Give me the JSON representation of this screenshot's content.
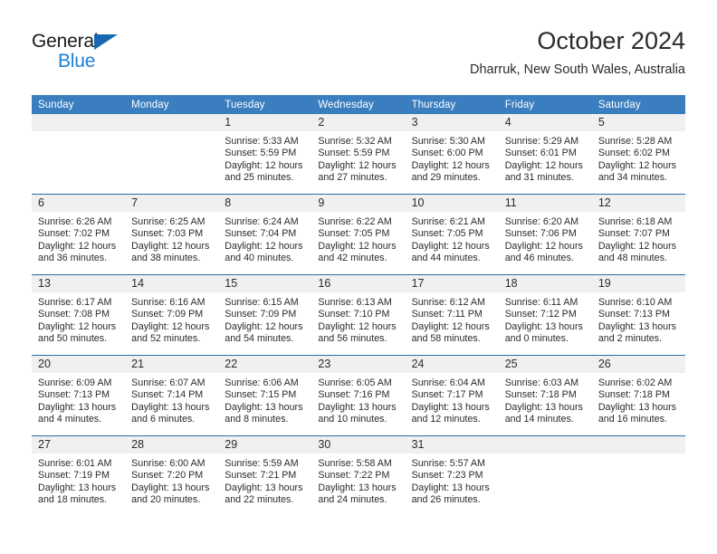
{
  "brand": {
    "name_top": "General",
    "name_bottom": "Blue",
    "triangle_icon": "triangle-icon",
    "color_black": "#1a1a1a",
    "color_blue": "#1b7fd4",
    "accent_blue": "#1668b3"
  },
  "header": {
    "title": "October 2024",
    "subtitle": "Dharruk, New South Wales, Australia"
  },
  "colors": {
    "header_row_bg": "#3a7ebf",
    "header_row_text": "#ffffff",
    "daynum_band_bg": "#f0f0f0",
    "week_separator": "#2e6da4",
    "body_text": "#2b2b2b"
  },
  "weekday_headers": [
    "Sunday",
    "Monday",
    "Tuesday",
    "Wednesday",
    "Thursday",
    "Friday",
    "Saturday"
  ],
  "labels": {
    "sunrise_prefix": "Sunrise:",
    "sunset_prefix": "Sunset:",
    "daylight_prefix": "Daylight:"
  },
  "weeks": [
    [
      {
        "day": "",
        "sunrise": "",
        "sunset": "",
        "daylight_line1": "",
        "daylight_line2": ""
      },
      {
        "day": "",
        "sunrise": "",
        "sunset": "",
        "daylight_line1": "",
        "daylight_line2": ""
      },
      {
        "day": "1",
        "sunrise": "Sunrise: 5:33 AM",
        "sunset": "Sunset: 5:59 PM",
        "daylight_line1": "Daylight: 12 hours",
        "daylight_line2": "and 25 minutes."
      },
      {
        "day": "2",
        "sunrise": "Sunrise: 5:32 AM",
        "sunset": "Sunset: 5:59 PM",
        "daylight_line1": "Daylight: 12 hours",
        "daylight_line2": "and 27 minutes."
      },
      {
        "day": "3",
        "sunrise": "Sunrise: 5:30 AM",
        "sunset": "Sunset: 6:00 PM",
        "daylight_line1": "Daylight: 12 hours",
        "daylight_line2": "and 29 minutes."
      },
      {
        "day": "4",
        "sunrise": "Sunrise: 5:29 AM",
        "sunset": "Sunset: 6:01 PM",
        "daylight_line1": "Daylight: 12 hours",
        "daylight_line2": "and 31 minutes."
      },
      {
        "day": "5",
        "sunrise": "Sunrise: 5:28 AM",
        "sunset": "Sunset: 6:02 PM",
        "daylight_line1": "Daylight: 12 hours",
        "daylight_line2": "and 34 minutes."
      }
    ],
    [
      {
        "day": "6",
        "sunrise": "Sunrise: 6:26 AM",
        "sunset": "Sunset: 7:02 PM",
        "daylight_line1": "Daylight: 12 hours",
        "daylight_line2": "and 36 minutes."
      },
      {
        "day": "7",
        "sunrise": "Sunrise: 6:25 AM",
        "sunset": "Sunset: 7:03 PM",
        "daylight_line1": "Daylight: 12 hours",
        "daylight_line2": "and 38 minutes."
      },
      {
        "day": "8",
        "sunrise": "Sunrise: 6:24 AM",
        "sunset": "Sunset: 7:04 PM",
        "daylight_line1": "Daylight: 12 hours",
        "daylight_line2": "and 40 minutes."
      },
      {
        "day": "9",
        "sunrise": "Sunrise: 6:22 AM",
        "sunset": "Sunset: 7:05 PM",
        "daylight_line1": "Daylight: 12 hours",
        "daylight_line2": "and 42 minutes."
      },
      {
        "day": "10",
        "sunrise": "Sunrise: 6:21 AM",
        "sunset": "Sunset: 7:05 PM",
        "daylight_line1": "Daylight: 12 hours",
        "daylight_line2": "and 44 minutes."
      },
      {
        "day": "11",
        "sunrise": "Sunrise: 6:20 AM",
        "sunset": "Sunset: 7:06 PM",
        "daylight_line1": "Daylight: 12 hours",
        "daylight_line2": "and 46 minutes."
      },
      {
        "day": "12",
        "sunrise": "Sunrise: 6:18 AM",
        "sunset": "Sunset: 7:07 PM",
        "daylight_line1": "Daylight: 12 hours",
        "daylight_line2": "and 48 minutes."
      }
    ],
    [
      {
        "day": "13",
        "sunrise": "Sunrise: 6:17 AM",
        "sunset": "Sunset: 7:08 PM",
        "daylight_line1": "Daylight: 12 hours",
        "daylight_line2": "and 50 minutes."
      },
      {
        "day": "14",
        "sunrise": "Sunrise: 6:16 AM",
        "sunset": "Sunset: 7:09 PM",
        "daylight_line1": "Daylight: 12 hours",
        "daylight_line2": "and 52 minutes."
      },
      {
        "day": "15",
        "sunrise": "Sunrise: 6:15 AM",
        "sunset": "Sunset: 7:09 PM",
        "daylight_line1": "Daylight: 12 hours",
        "daylight_line2": "and 54 minutes."
      },
      {
        "day": "16",
        "sunrise": "Sunrise: 6:13 AM",
        "sunset": "Sunset: 7:10 PM",
        "daylight_line1": "Daylight: 12 hours",
        "daylight_line2": "and 56 minutes."
      },
      {
        "day": "17",
        "sunrise": "Sunrise: 6:12 AM",
        "sunset": "Sunset: 7:11 PM",
        "daylight_line1": "Daylight: 12 hours",
        "daylight_line2": "and 58 minutes."
      },
      {
        "day": "18",
        "sunrise": "Sunrise: 6:11 AM",
        "sunset": "Sunset: 7:12 PM",
        "daylight_line1": "Daylight: 13 hours",
        "daylight_line2": "and 0 minutes."
      },
      {
        "day": "19",
        "sunrise": "Sunrise: 6:10 AM",
        "sunset": "Sunset: 7:13 PM",
        "daylight_line1": "Daylight: 13 hours",
        "daylight_line2": "and 2 minutes."
      }
    ],
    [
      {
        "day": "20",
        "sunrise": "Sunrise: 6:09 AM",
        "sunset": "Sunset: 7:13 PM",
        "daylight_line1": "Daylight: 13 hours",
        "daylight_line2": "and 4 minutes."
      },
      {
        "day": "21",
        "sunrise": "Sunrise: 6:07 AM",
        "sunset": "Sunset: 7:14 PM",
        "daylight_line1": "Daylight: 13 hours",
        "daylight_line2": "and 6 minutes."
      },
      {
        "day": "22",
        "sunrise": "Sunrise: 6:06 AM",
        "sunset": "Sunset: 7:15 PM",
        "daylight_line1": "Daylight: 13 hours",
        "daylight_line2": "and 8 minutes."
      },
      {
        "day": "23",
        "sunrise": "Sunrise: 6:05 AM",
        "sunset": "Sunset: 7:16 PM",
        "daylight_line1": "Daylight: 13 hours",
        "daylight_line2": "and 10 minutes."
      },
      {
        "day": "24",
        "sunrise": "Sunrise: 6:04 AM",
        "sunset": "Sunset: 7:17 PM",
        "daylight_line1": "Daylight: 13 hours",
        "daylight_line2": "and 12 minutes."
      },
      {
        "day": "25",
        "sunrise": "Sunrise: 6:03 AM",
        "sunset": "Sunset: 7:18 PM",
        "daylight_line1": "Daylight: 13 hours",
        "daylight_line2": "and 14 minutes."
      },
      {
        "day": "26",
        "sunrise": "Sunrise: 6:02 AM",
        "sunset": "Sunset: 7:18 PM",
        "daylight_line1": "Daylight: 13 hours",
        "daylight_line2": "and 16 minutes."
      }
    ],
    [
      {
        "day": "27",
        "sunrise": "Sunrise: 6:01 AM",
        "sunset": "Sunset: 7:19 PM",
        "daylight_line1": "Daylight: 13 hours",
        "daylight_line2": "and 18 minutes."
      },
      {
        "day": "28",
        "sunrise": "Sunrise: 6:00 AM",
        "sunset": "Sunset: 7:20 PM",
        "daylight_line1": "Daylight: 13 hours",
        "daylight_line2": "and 20 minutes."
      },
      {
        "day": "29",
        "sunrise": "Sunrise: 5:59 AM",
        "sunset": "Sunset: 7:21 PM",
        "daylight_line1": "Daylight: 13 hours",
        "daylight_line2": "and 22 minutes."
      },
      {
        "day": "30",
        "sunrise": "Sunrise: 5:58 AM",
        "sunset": "Sunset: 7:22 PM",
        "daylight_line1": "Daylight: 13 hours",
        "daylight_line2": "and 24 minutes."
      },
      {
        "day": "31",
        "sunrise": "Sunrise: 5:57 AM",
        "sunset": "Sunset: 7:23 PM",
        "daylight_line1": "Daylight: 13 hours",
        "daylight_line2": "and 26 minutes."
      },
      {
        "day": "",
        "sunrise": "",
        "sunset": "",
        "daylight_line1": "",
        "daylight_line2": ""
      },
      {
        "day": "",
        "sunrise": "",
        "sunset": "",
        "daylight_line1": "",
        "daylight_line2": ""
      }
    ]
  ]
}
